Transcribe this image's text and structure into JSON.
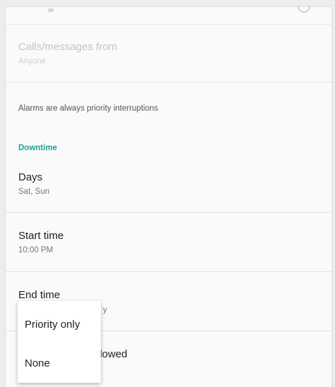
{
  "calls_messages": {
    "title": "Calls/messages from",
    "summary": "Anyone"
  },
  "alarms_note": "Alarms are always priority interruptions",
  "downtime": {
    "header": "Downtime",
    "days": {
      "title": "Days",
      "summary": "Sat, Sun"
    },
    "start_time": {
      "title": "Start time",
      "summary": "10:00 PM"
    },
    "end_time": {
      "title": "End time",
      "summary_visible_fragment": "y"
    },
    "interruptions_allowed": {
      "title_visible_fragment": "llowed"
    }
  },
  "popup_menu": {
    "items": [
      "Priority only",
      "None"
    ]
  }
}
